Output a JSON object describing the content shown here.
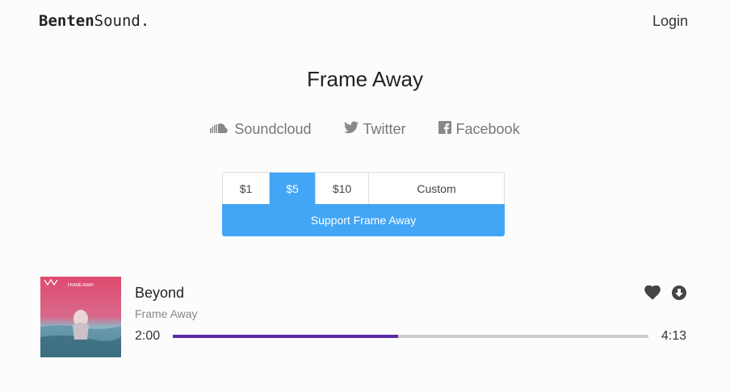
{
  "header": {
    "logo_bold": "Benten",
    "logo_rest": "Sound.",
    "login_label": "Login"
  },
  "artist": {
    "name": "Frame Away"
  },
  "socials": [
    {
      "label": "Soundcloud",
      "icon": "soundcloud-icon"
    },
    {
      "label": "Twitter",
      "icon": "twitter-icon"
    },
    {
      "label": "Facebook",
      "icon": "facebook-icon"
    }
  ],
  "donate": {
    "amounts": [
      "$1",
      "$5",
      "$10",
      "Custom"
    ],
    "selected": "$5",
    "support_label": "Support Frame Away",
    "accent": "#42a5f5"
  },
  "track": {
    "title": "Beyond",
    "artist": "Frame Away",
    "current_time": "2:00",
    "duration": "4:13",
    "progress": 0.474,
    "progress_color": "#5b2aa8",
    "cover_text": "FRAME AWAY",
    "actions": [
      "heart-icon",
      "download-icon"
    ]
  }
}
